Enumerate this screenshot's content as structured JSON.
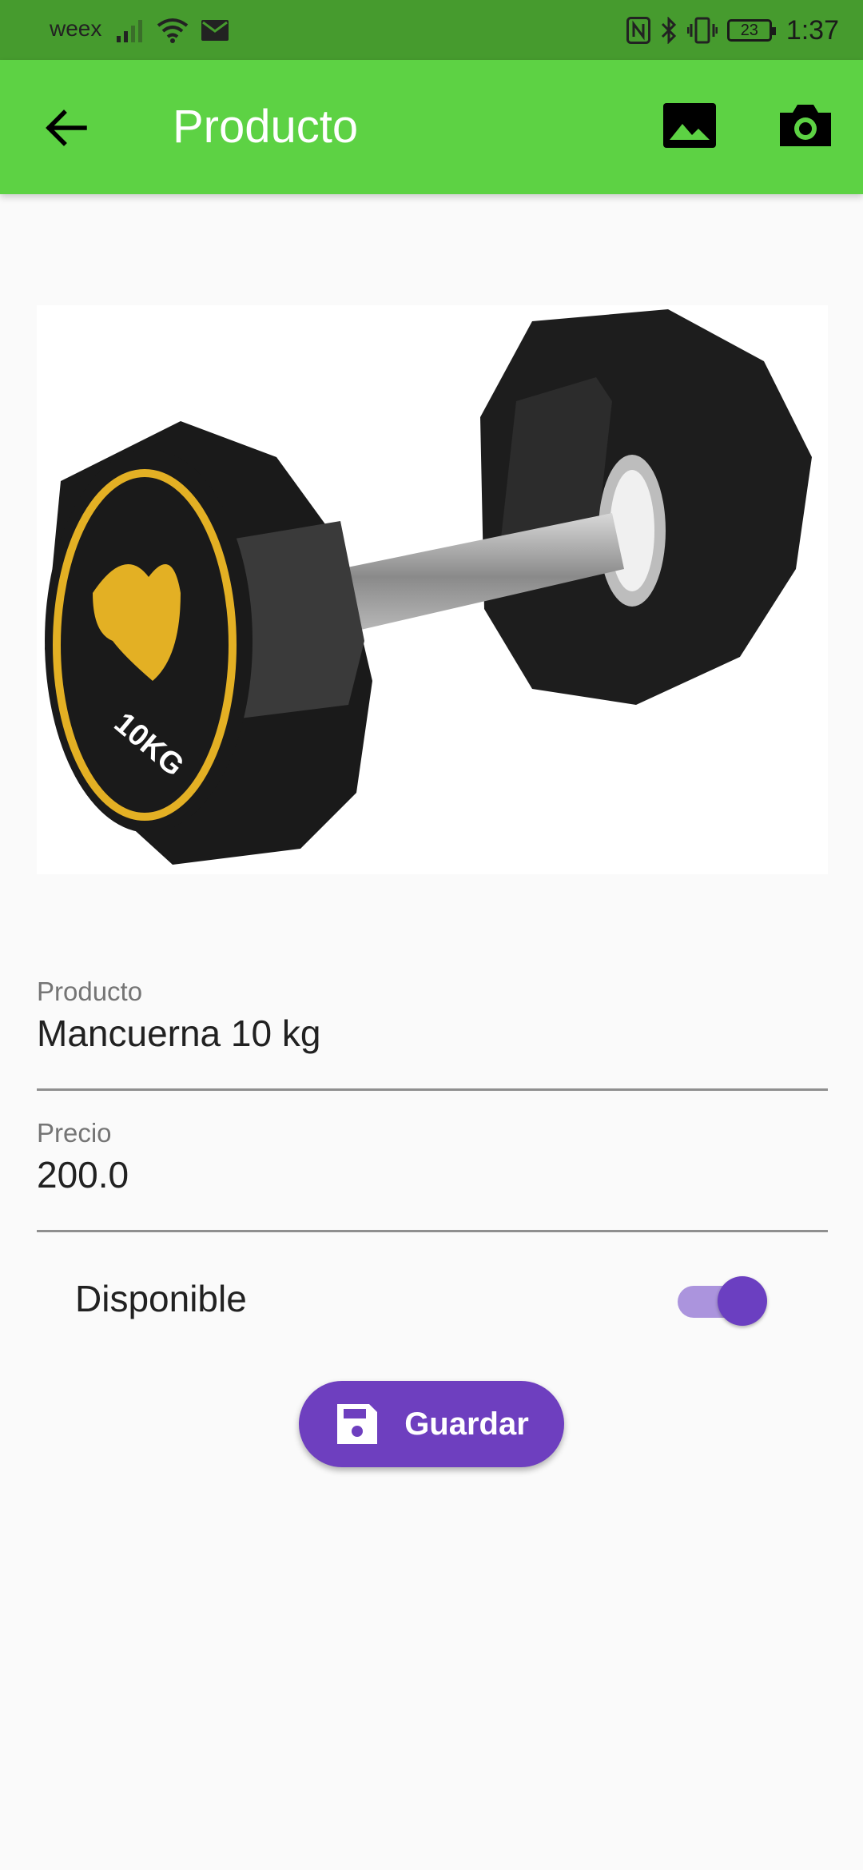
{
  "status_bar": {
    "carrier": "weex",
    "battery": "23",
    "time": "1:37",
    "icons": [
      "signal-icon",
      "wifi-icon",
      "mail-icon",
      "nfc-icon",
      "bluetooth-icon",
      "vibrate-icon",
      "battery-icon"
    ]
  },
  "app_bar": {
    "title": "Producto",
    "back_icon": "arrow-back-icon",
    "actions": [
      "image-icon",
      "camera-icon"
    ],
    "color": "#5dd244"
  },
  "product_image": {
    "subject": "dumbbell",
    "plate_text": "10KG"
  },
  "form": {
    "producto": {
      "label": "Producto",
      "value": "Mancuerna 10 kg"
    },
    "precio": {
      "label": "Precio",
      "value": "200.0"
    },
    "disponible": {
      "label": "Disponible",
      "checked": true
    }
  },
  "save_button": {
    "label": "Guardar",
    "icon": "save-icon",
    "color": "#6e3fbf"
  }
}
